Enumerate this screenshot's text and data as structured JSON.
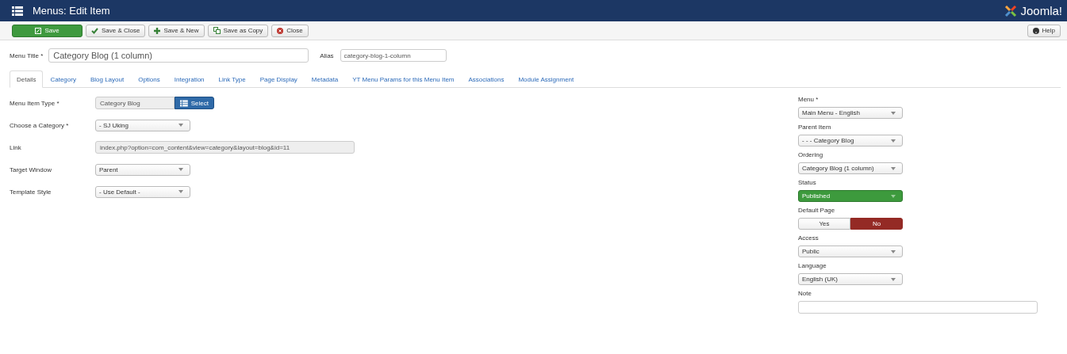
{
  "header": {
    "title": "Menus: Edit Item",
    "brand": "Joomla!"
  },
  "toolbar": {
    "buttons": [
      {
        "label": "Save",
        "kind": "primary"
      },
      {
        "label": "Save & Close",
        "kind": "check"
      },
      {
        "label": "Save & New",
        "kind": "plus"
      },
      {
        "label": "Save as Copy",
        "kind": "copy"
      },
      {
        "label": "Close",
        "kind": "close"
      }
    ],
    "help": "Help"
  },
  "title_field": {
    "label": "Menu Title *",
    "value": "Category Blog (1 column)"
  },
  "alias_field": {
    "label": "Alias",
    "value": "category-blog-1-column"
  },
  "tabs": [
    {
      "label": "Details",
      "selected": true
    },
    {
      "label": "Category",
      "selected": false
    },
    {
      "label": "Blog Layout",
      "selected": false
    },
    {
      "label": "Options",
      "selected": false
    },
    {
      "label": "Integration",
      "selected": false
    },
    {
      "label": "Link Type",
      "selected": false
    },
    {
      "label": "Page Display",
      "selected": false
    },
    {
      "label": "Metadata",
      "selected": false
    },
    {
      "label": "YT Menu Params for this Menu Item",
      "selected": false
    },
    {
      "label": "Associations",
      "selected": false
    },
    {
      "label": "Module Assignment",
      "selected": false
    }
  ],
  "main_fields": [
    {
      "label": "Menu Item Type *",
      "kind": "modal",
      "value": "Category Blog",
      "button": "Select"
    },
    {
      "label": "Choose a Category *",
      "kind": "select",
      "value": "- SJ Uking"
    },
    {
      "label": "Link",
      "kind": "readonly",
      "value": "index.php?option=com_content&view=category&layout=blog&id=11"
    },
    {
      "label": "Target Window",
      "kind": "select",
      "value": "Parent"
    },
    {
      "label": "Template Style",
      "kind": "select",
      "value": "- Use Default -"
    }
  ],
  "side_fields": [
    {
      "label": "Menu *",
      "kind": "select",
      "value": "Main Menu - English"
    },
    {
      "label": "Parent Item",
      "kind": "select",
      "value": "- - - Category Blog"
    },
    {
      "label": "Ordering",
      "kind": "select",
      "value": "Category Blog (1 column)"
    },
    {
      "label": "Status",
      "kind": "status",
      "value": "Published",
      "color": "#3d9a3d"
    },
    {
      "label": "Default Page",
      "kind": "toggle",
      "options": [
        {
          "label": "Yes",
          "selected": false
        },
        {
          "label": "No",
          "selected": true
        }
      ]
    },
    {
      "label": "Access",
      "kind": "select",
      "value": "Public"
    },
    {
      "label": "Language",
      "kind": "select",
      "value": "English (UK)"
    },
    {
      "label": "Note",
      "kind": "text"
    }
  ]
}
